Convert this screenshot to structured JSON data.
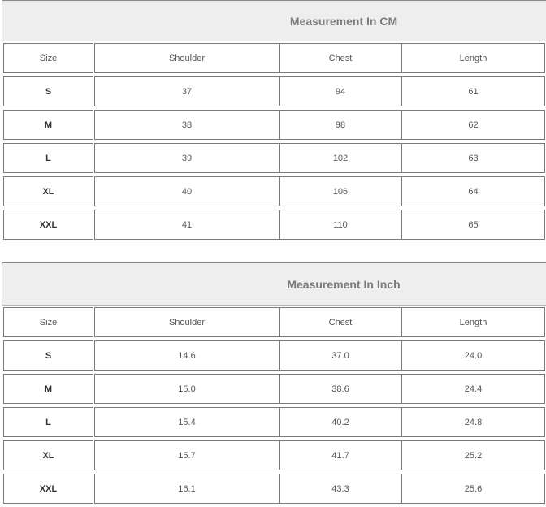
{
  "tables": [
    {
      "title": "Measurement In CM",
      "headers": [
        "Size",
        "Shoulder",
        "Chest",
        "Length"
      ],
      "rows": [
        [
          "S",
          "37",
          "94",
          "61"
        ],
        [
          "M",
          "38",
          "98",
          "62"
        ],
        [
          "L",
          "39",
          "102",
          "63"
        ],
        [
          "XL",
          "40",
          "106",
          "64"
        ],
        [
          "XXL",
          "41",
          "110",
          "65"
        ]
      ]
    },
    {
      "title": "Measurement In Inch",
      "headers": [
        "Size",
        "Shoulder",
        "Chest",
        "Length"
      ],
      "rows": [
        [
          "S",
          "14.6",
          "37.0",
          "24.0"
        ],
        [
          "M",
          "15.0",
          "38.6",
          "24.4"
        ],
        [
          "L",
          "15.4",
          "40.2",
          "24.8"
        ],
        [
          "XL",
          "15.7",
          "41.7",
          "25.2"
        ],
        [
          "XXL",
          "16.1",
          "43.3",
          "25.6"
        ]
      ]
    }
  ]
}
